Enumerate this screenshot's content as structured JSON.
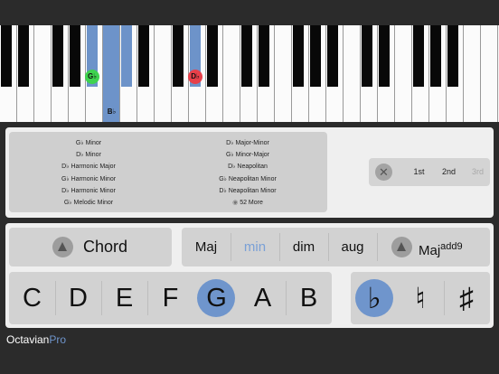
{
  "keyboard": {
    "white_keys": 29,
    "highlighted_white": [
      6
    ],
    "black_key_count": 20,
    "highlighted_black": [
      4,
      5,
      8
    ],
    "markers": [
      {
        "label": "G♭",
        "color": "#3fd34f",
        "key": "black-4"
      },
      {
        "label": "B♭",
        "color": "#6d93c9",
        "key": "white-6"
      },
      {
        "label": "D♭",
        "color": "#e8404a",
        "key": "black-8"
      }
    ]
  },
  "scales": {
    "left": [
      "G♭ Minor",
      "D♭ Minor",
      "D♭ Harmonic Major",
      "G♭ Harmonic Minor",
      "D♭ Harmonic Minor",
      "G♭ Melodic Minor"
    ],
    "right": [
      "D♭ Major-Minor",
      "G♭ Minor-Major",
      "D♭ Neapolitan",
      "G♭ Neapolitan Minor",
      "D♭ Neapolitan Minor"
    ],
    "more": "52 More"
  },
  "inversions": {
    "clear_symbol": "✕",
    "buttons": [
      "1st",
      "2nd",
      "3rd"
    ],
    "disabled": [
      2
    ]
  },
  "chord": {
    "type_label": "Chord",
    "qualities": [
      "Maj",
      "min",
      "dim",
      "aug"
    ],
    "selected_quality": 1,
    "extension_base": "Maj",
    "extension_sup": "add9"
  },
  "notes": {
    "names": [
      "C",
      "D",
      "E",
      "F",
      "G",
      "A",
      "B"
    ],
    "selected": 4
  },
  "accidentals": {
    "symbols": [
      "♭",
      "♮",
      "♯"
    ],
    "selected": 0
  },
  "brand": {
    "name": "Octavian",
    "suffix": "Pro"
  },
  "colors": {
    "accent": "#6f95cc",
    "green": "#3fd34f",
    "red": "#e8404a"
  }
}
